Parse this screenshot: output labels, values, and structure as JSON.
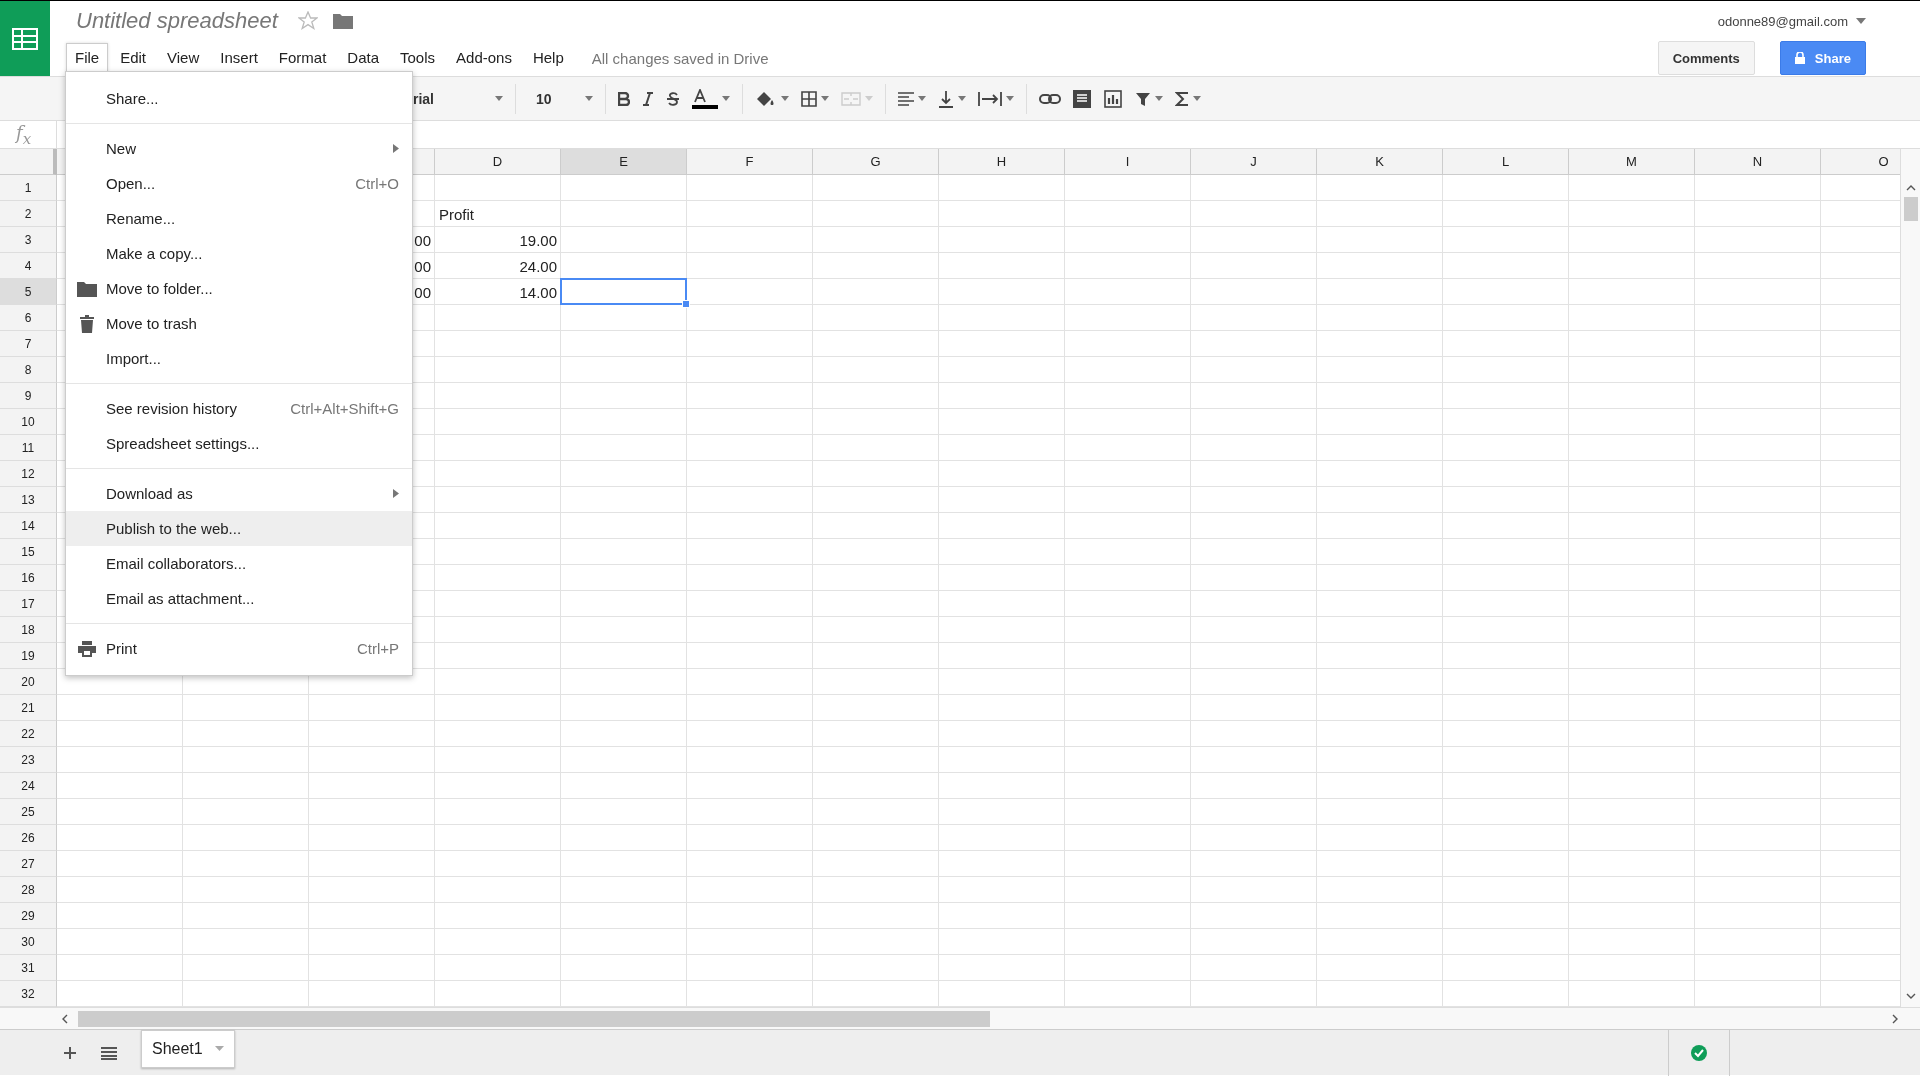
{
  "app": {
    "title": "Untitled spreadsheet",
    "account": "odonne89@gmail.com",
    "starred": false,
    "save_status": "All changes saved in Drive"
  },
  "menu_bar": [
    {
      "label": "File",
      "selected": true
    },
    {
      "label": "Edit",
      "selected": false
    },
    {
      "label": "View",
      "selected": false
    },
    {
      "label": "Insert",
      "selected": false
    },
    {
      "label": "Format",
      "selected": false
    },
    {
      "label": "Data",
      "selected": false
    },
    {
      "label": "Tools",
      "selected": false
    },
    {
      "label": "Add-ons",
      "selected": false
    },
    {
      "label": "Help",
      "selected": false
    }
  ],
  "buttons": [
    {
      "label": "Comments",
      "kind": "plain"
    },
    {
      "label": "Share",
      "kind": "primary"
    }
  ],
  "toolbar": {
    "font": "rial",
    "font_size": "10"
  },
  "formula_bar": {
    "label": "f$_{x}$"
  },
  "file_menu": [
    {
      "label": "Share...",
      "kind": "item",
      "highlighted": false
    },
    {
      "kind": "divider"
    },
    {
      "label": "New",
      "kind": "submenu",
      "highlighted": false
    },
    {
      "label": "Open...",
      "shortcut": "Ctrl+O",
      "kind": "item",
      "highlighted": false
    },
    {
      "label": "Rename...",
      "kind": "item",
      "highlighted": false
    },
    {
      "label": "Make a copy...",
      "kind": "item",
      "highlighted": false
    },
    {
      "label": "Move to folder...",
      "kind": "folder",
      "highlighted": false
    },
    {
      "label": "Move to trash",
      "kind": "trash",
      "highlighted": false
    },
    {
      "label": "Import...",
      "kind": "item",
      "highlighted": false
    },
    {
      "kind": "divider"
    },
    {
      "label": "See revision history",
      "shortcut": "Ctrl+Alt+Shift+G",
      "kind": "item",
      "highlighted": false
    },
    {
      "label": "Spreadsheet settings...",
      "kind": "item",
      "highlighted": false
    },
    {
      "kind": "divider"
    },
    {
      "label": "Download as",
      "kind": "submenu",
      "highlighted": false
    },
    {
      "label": "Publish to the web...",
      "kind": "item",
      "highlighted": true
    },
    {
      "label": "Email collaborators...",
      "kind": "item",
      "highlighted": false
    },
    {
      "label": "Email as attachment...",
      "kind": "item",
      "highlighted": false
    },
    {
      "kind": "divider"
    },
    {
      "label": "Print",
      "shortcut": "Ctrl+P",
      "kind": "printer",
      "highlighted": false
    }
  ],
  "grid": {
    "columns": [
      {
        "label": "D",
        "selected": false
      },
      {
        "label": "E",
        "selected": true
      },
      {
        "label": "F",
        "selected": false
      },
      {
        "label": "G",
        "selected": false
      },
      {
        "label": "H",
        "selected": false
      },
      {
        "label": "I",
        "selected": false
      },
      {
        "label": "J",
        "selected": false
      },
      {
        "label": "K",
        "selected": false
      },
      {
        "label": "L",
        "selected": false
      },
      {
        "label": "M",
        "selected": false
      },
      {
        "label": "N",
        "selected": false
      },
      {
        "label": "O",
        "selected": false
      }
    ],
    "rows": [
      {
        "label": "1",
        "selected": false
      },
      {
        "label": "2",
        "selected": false,
        "cells": [
          {
            "text": "Profit",
            "kind": "text"
          }
        ]
      },
      {
        "label": "3",
        "selected": false,
        "column_c": "00",
        "cells": [
          {
            "text": "19.00",
            "kind": "number"
          }
        ]
      },
      {
        "label": "4",
        "selected": false,
        "column_c": "00",
        "cells": [
          {
            "text": "24.00",
            "kind": "number"
          }
        ]
      },
      {
        "label": "5",
        "selected": true,
        "column_c": "00",
        "cells": [
          {
            "text": "14.00",
            "kind": "number"
          },
          {
            "kind": "empty",
            "active": true
          }
        ]
      },
      {
        "label": "6",
        "selected": false
      },
      {
        "label": "7",
        "selected": false
      },
      {
        "label": "8",
        "selected": false
      },
      {
        "label": "9",
        "selected": false
      },
      {
        "label": "10",
        "selected": false
      },
      {
        "label": "11",
        "selected": false
      },
      {
        "label": "12",
        "selected": false
      },
      {
        "label": "13",
        "selected": false
      },
      {
        "label": "14",
        "selected": false
      },
      {
        "label": "15",
        "selected": false
      },
      {
        "label": "16",
        "selected": false
      },
      {
        "label": "17",
        "selected": false
      },
      {
        "label": "18",
        "selected": false
      },
      {
        "label": "19",
        "selected": false
      },
      {
        "label": "20",
        "selected": false
      },
      {
        "label": "21",
        "selected": false
      },
      {
        "label": "22",
        "selected": false
      },
      {
        "label": "23",
        "selected": false
      },
      {
        "label": "24",
        "selected": false
      },
      {
        "label": "25",
        "selected": false
      },
      {
        "label": "26",
        "selected": false
      },
      {
        "label": "27",
        "selected": false
      },
      {
        "label": "28",
        "selected": false
      },
      {
        "label": "29",
        "selected": false
      },
      {
        "label": "30",
        "selected": false
      },
      {
        "label": "31",
        "selected": false
      },
      {
        "label": "32",
        "selected": false
      }
    ]
  },
  "sheet_tabs": [
    {
      "label": "Sheet1",
      "selected": true
    }
  ]
}
